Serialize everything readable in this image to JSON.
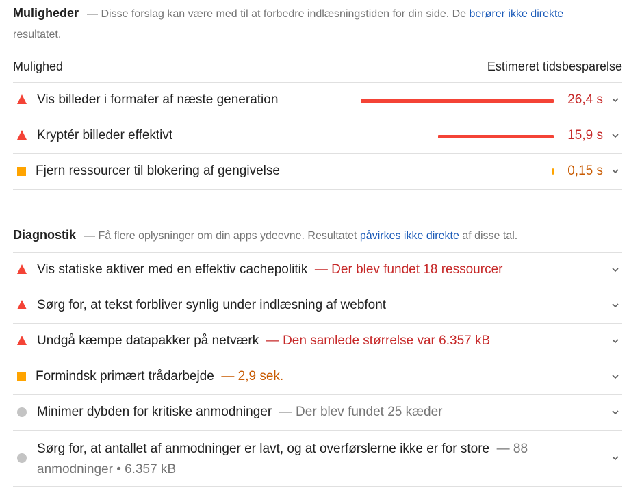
{
  "opportunities": {
    "title": "Muligheder",
    "desc_prefix": "— Disse forslag kan være med til at forbedre indlæsningstiden for din side. De ",
    "desc_link": "berører ikke direkte",
    "desc_suffix": " resultatet.",
    "col_left": "Mulighed",
    "col_right": "Estimeret tidsbesparelse",
    "items": [
      {
        "label": "Vis billeder i formater af næste generation",
        "saving": "26,4 s",
        "status": "fail",
        "level": 1.0
      },
      {
        "label": "Kryptér billeder effektivt",
        "saving": "15,9 s",
        "status": "fail",
        "level": 0.6
      },
      {
        "label": "Fjern ressourcer til blokering af gengivelse",
        "saving": "0,15 s",
        "status": "average",
        "level": 0.006
      }
    ]
  },
  "diagnostics": {
    "title": "Diagnostik",
    "desc_prefix": "— Få flere oplysninger om din apps ydeevne. Resultatet ",
    "desc_link": "påvirkes ikke direkte",
    "desc_suffix": " af disse tal.",
    "items": [
      {
        "label": "Vis statiske aktiver med en effektiv cachepolitik",
        "detail": "— Der blev fundet 18 ressourcer",
        "status": "fail"
      },
      {
        "label": "Sørg for, at tekst forbliver synlig under indlæsning af webfont",
        "detail": "",
        "status": "fail"
      },
      {
        "label": "Undgå kæmpe datapakker på netværk",
        "detail": "— Den samlede størrelse var 6.357 kB",
        "status": "fail"
      },
      {
        "label": "Formindsk primært trådarbejde",
        "detail": "— 2,9 sek.",
        "status": "average"
      },
      {
        "label": "Minimer dybden for kritiske anmodninger",
        "detail": "— Der blev fundet 25 kæder",
        "status": "info"
      },
      {
        "label": "Sørg for, at antallet af anmodninger er lavt, og at overførslerne ikke er for store",
        "detail": "— 88 anmodninger • 6.357 kB",
        "status": "info"
      }
    ]
  },
  "colors": {
    "fail": "#f44336",
    "average": "#ffa400",
    "info": "#c4c4c4",
    "link": "#1a5ab8"
  },
  "icons": {
    "fail": "triangle-icon",
    "average": "square-icon",
    "info": "circle-icon",
    "expand": "chevron-down-icon"
  }
}
